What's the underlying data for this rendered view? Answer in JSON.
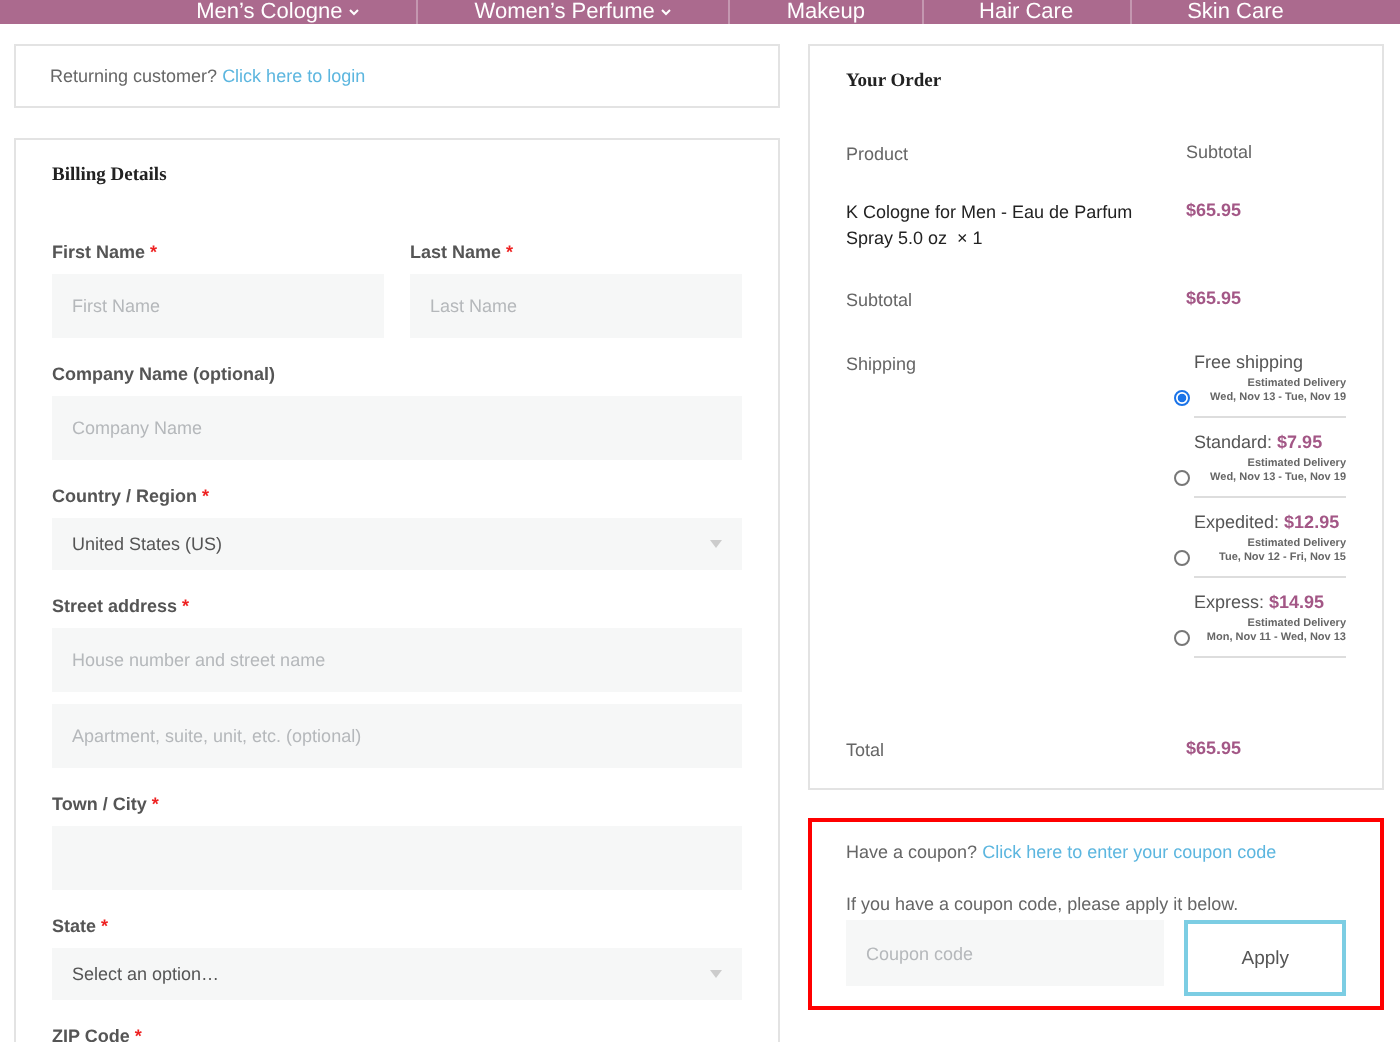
{
  "nav": [
    {
      "label": "Men’s Cologne",
      "dropdown": true
    },
    {
      "label": "Women’s Perfume",
      "dropdown": true
    },
    {
      "label": "Makeup",
      "dropdown": false
    },
    {
      "label": "Hair Care",
      "dropdown": false
    },
    {
      "label": "Skin Care",
      "dropdown": false
    }
  ],
  "login_notice": {
    "text": "Returning customer?",
    "link": "Click here to login"
  },
  "billing": {
    "title": "Billing Details",
    "rows": [
      [
        {
          "label": "First Name",
          "required_mark": "*",
          "kind": "input",
          "placeholders": [
            "First Name"
          ]
        },
        {
          "label": "Last Name",
          "required_mark": "*",
          "kind": "input",
          "placeholders": [
            "Last Name"
          ]
        }
      ],
      [
        {
          "label": "Company Name (optional)",
          "kind": "input",
          "placeholders": [
            "Company Name"
          ]
        }
      ],
      [
        {
          "label": "Country / Region",
          "required_mark": "*",
          "kind": "select",
          "value": "United States (US)"
        }
      ],
      [
        {
          "label": "Street address",
          "required_mark": "*",
          "kind": "input",
          "placeholders": [
            "House number and street name",
            "Apartment, suite, unit, etc. (optional)"
          ]
        }
      ],
      [
        {
          "label": "Town / City",
          "required_mark": "*",
          "kind": "input"
        }
      ],
      [
        {
          "label": "State",
          "required_mark": "*",
          "kind": "select",
          "value": "Select an option…"
        }
      ],
      [
        {
          "label": "ZIP Code",
          "required_mark": "*",
          "kind": "label"
        }
      ]
    ]
  },
  "order": {
    "title": "Your Order",
    "columns": [
      "Product",
      "Subtotal"
    ],
    "item": {
      "name": "K Cologne for Men - Eau de Parfum Spray 5.0 oz",
      "quantity": "× 1",
      "price": "$65.95"
    },
    "subtotal": {
      "label": "Subtotal",
      "value": "$65.95"
    },
    "shipping_label": "Shipping",
    "shipping_options": [
      {
        "name": "Free shipping",
        "selected": true,
        "delivery_label": "Estimated Delivery",
        "dates": "Wed, Nov 13 - Tue, Nov 19"
      },
      {
        "name": "Standard:",
        "price": "$7.95",
        "selected": false,
        "delivery_label": "Estimated Delivery",
        "dates": "Wed, Nov 13 - Tue, Nov 19"
      },
      {
        "name": "Expedited:",
        "price": "$12.95",
        "selected": false,
        "delivery_label": "Estimated Delivery",
        "dates": "Tue, Nov 12 - Fri, Nov 15"
      },
      {
        "name": "Express:",
        "price": "$14.95",
        "selected": false,
        "delivery_label": "Estimated Delivery",
        "dates": "Mon, Nov 11 - Wed, Nov 13"
      }
    ],
    "total": {
      "label": "Total",
      "value": "$65.95"
    }
  },
  "coupon": {
    "text": "Have a coupon?",
    "link": "Click here to enter your coupon code",
    "hint": "If you have a coupon code, please apply it below.",
    "placeholder": "Coupon code",
    "button": "Apply"
  }
}
